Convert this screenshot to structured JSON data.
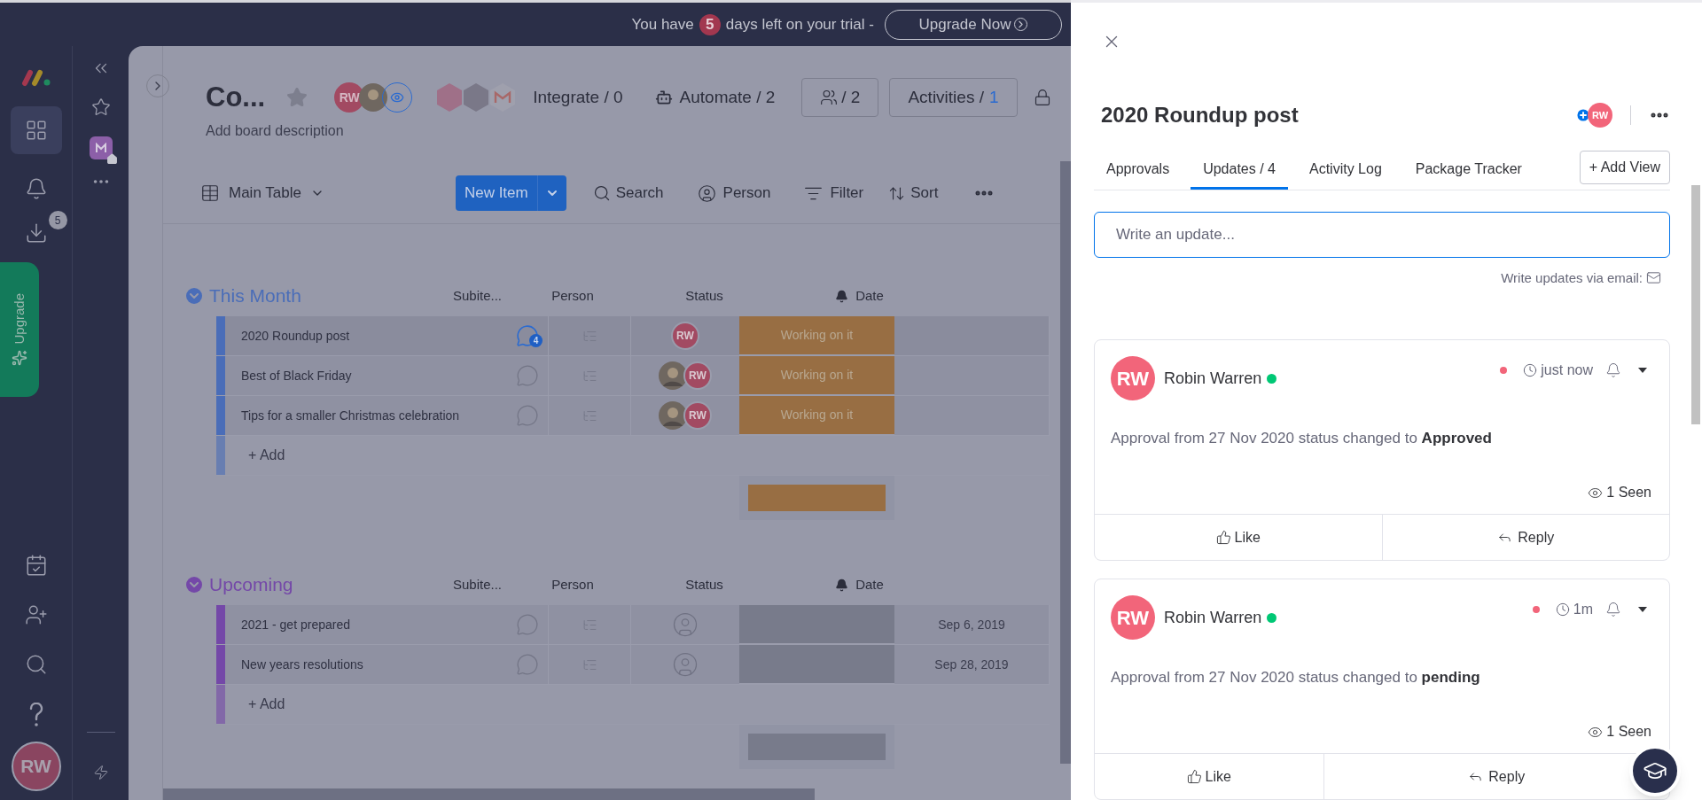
{
  "trial_banner": {
    "prefix": "You have",
    "days": "5",
    "suffix": "days left on your trial -",
    "button": "Upgrade Now"
  },
  "left_rail": {
    "notifications_badge": "5",
    "upgrade": "Upgrade",
    "avatar": "RW"
  },
  "board": {
    "title": "Co...",
    "description": "Add board description",
    "owner_initials": "RW",
    "integrate": "Integrate / 0",
    "automate": "Automate / 2",
    "members": "/ 2",
    "activities": {
      "label": "Activities /",
      "count": "1"
    },
    "view": "Main Table",
    "new_item": "New Item",
    "toolbar": [
      "Search",
      "Person",
      "Filter",
      "Sort"
    ]
  },
  "groups": [
    {
      "title": "This Month",
      "color": "#4a6db8",
      "columns": [
        "Subite...",
        "Person",
        "Status",
        "Date"
      ],
      "add": "+ Add",
      "rows": [
        {
          "name": "2020 Roundup post",
          "selected": true,
          "updates": "4",
          "people": [
            {
              "kind": "initials",
              "text": "RW"
            }
          ],
          "status": {
            "label": "Working on it",
            "color": "#986e43"
          }
        },
        {
          "name": "Best of Black Friday",
          "selected": false,
          "people": [
            {
              "kind": "photo"
            },
            {
              "kind": "initials",
              "text": "RW"
            }
          ],
          "status": {
            "label": "Working on it",
            "color": "#986e43"
          }
        },
        {
          "name": "Tips for a smaller Christmas celebration",
          "selected": false,
          "people": [
            {
              "kind": "photo"
            },
            {
              "kind": "initials",
              "text": "RW"
            }
          ],
          "status": {
            "label": "Working on it",
            "color": "#986e43"
          }
        }
      ]
    },
    {
      "title": "Upcoming",
      "color": "#7448a8",
      "columns": [
        "Subite...",
        "Person",
        "Status",
        "Date"
      ],
      "add": "+ Add",
      "rows": [
        {
          "name": "2021 - get prepared",
          "selected": false,
          "people": [
            {
              "kind": "empty"
            }
          ],
          "status": {
            "color": "#787b8b"
          },
          "date": "Sep 6, 2019"
        },
        {
          "name": "New years resolutions",
          "selected": false,
          "people": [
            {
              "kind": "empty"
            }
          ],
          "status": {
            "color": "#787b8b"
          },
          "date": "Sep 28, 2019"
        }
      ]
    }
  ],
  "panel": {
    "title": "2020 Roundup post",
    "subscriber": "RW",
    "tabs": [
      {
        "label": "Approvals",
        "selected": false
      },
      {
        "label": "Updates / 4",
        "selected": true
      },
      {
        "label": "Activity Log",
        "selected": false
      },
      {
        "label": "Package Tracker",
        "selected": false
      }
    ],
    "add_view": "+ Add View",
    "placeholder": "Write an update...",
    "email_hint": "Write updates via email:",
    "posts": [
      {
        "initials": "RW",
        "author": "Robin Warren",
        "online": true,
        "unread": true,
        "time": "just now",
        "body": "Approval from 27 Nov 2020 status changed to **Approved**",
        "seen": "1 Seen",
        "actions": [
          "Like",
          "Reply"
        ]
      },
      {
        "initials": "RW",
        "author": "Robin Warren",
        "online": true,
        "unread": true,
        "time": "1m",
        "body": "Approval from 27 Nov 2020 status changed to **pending**",
        "seen": "1 Seen",
        "actions": [
          "Like",
          "Reply"
        ]
      }
    ]
  }
}
